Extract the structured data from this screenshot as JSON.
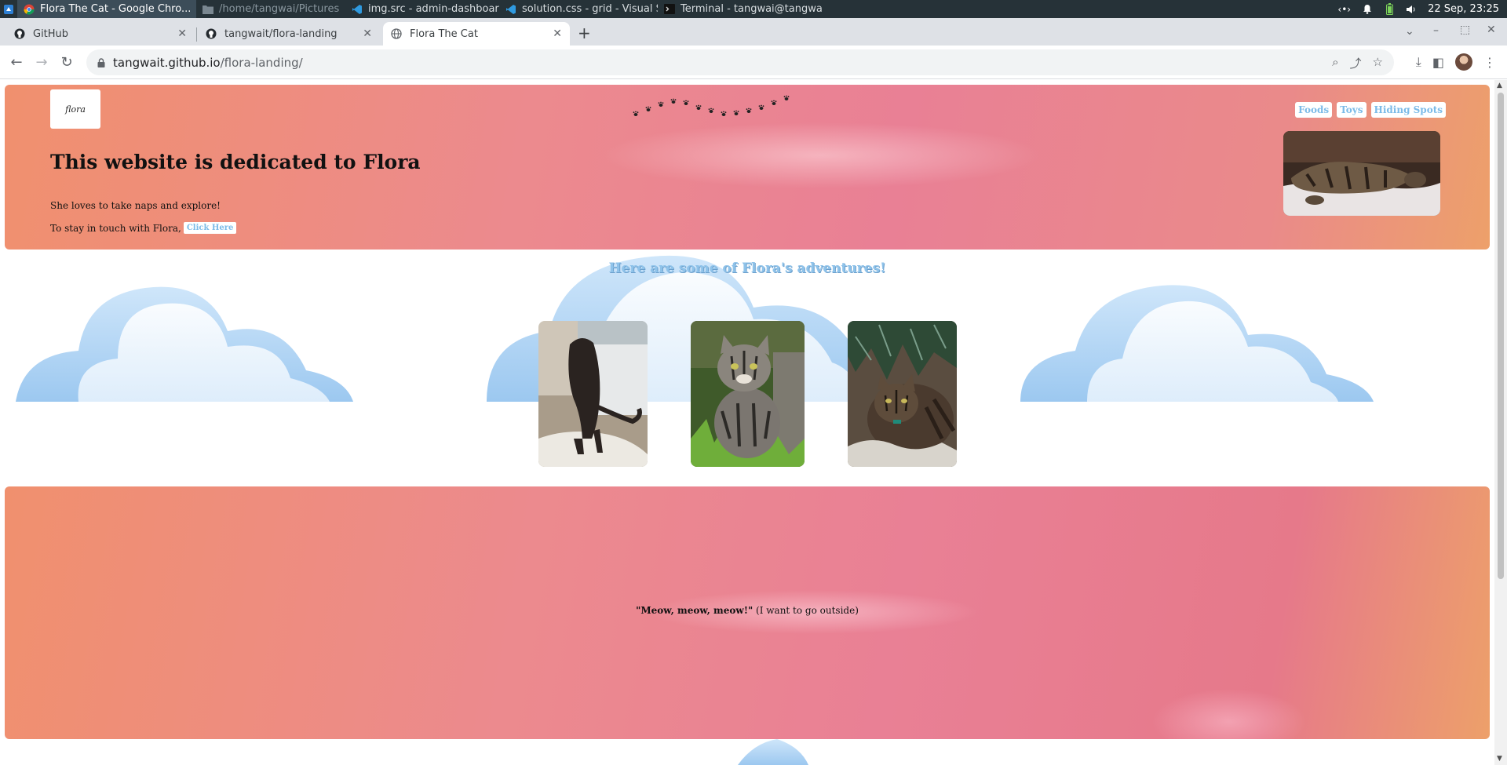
{
  "taskbar": {
    "windows": [
      {
        "title": "Flora The Cat - Google Chro...",
        "icon": "chrome-icon"
      },
      {
        "title": "/home/tangwai/Pictures",
        "icon": "folder-icon"
      },
      {
        "title": "img.src - admin-dashboard -...",
        "icon": "vscode-icon"
      },
      {
        "title": "solution.css - grid - Visual St...",
        "icon": "vscode-icon"
      },
      {
        "title": "Terminal - tangwai@tangwai...",
        "icon": "terminal-icon"
      }
    ],
    "clock": "22 Sep, 23:25"
  },
  "browser": {
    "tabs": [
      {
        "title": "GitHub",
        "icon": "github-icon"
      },
      {
        "title": "tangwait/flora-landing",
        "icon": "github-icon"
      },
      {
        "title": "Flora The Cat",
        "icon": "globe-icon"
      }
    ],
    "url_host": "tangwait.github.io",
    "url_path": "/flora-landing/"
  },
  "page": {
    "logo_text": "flora",
    "nav": [
      "Foods",
      "Toys",
      "Hiding Spots"
    ],
    "hero_title": "This website is dedicated to Flora",
    "hero_p1": "She loves to take naps and explore!",
    "hero_p2": "To stay in touch with Flora,",
    "cta": "Click Here",
    "adventures_title": "Here are some of Flora's adventures!",
    "quote_bold": "\"Meow, meow, meow!\"",
    "quote_rest": " (I want to go outside)"
  },
  "colors": {
    "accent_blue": "#7bbbe8",
    "hero_coral": "#f0906e",
    "hero_pink": "#e98095"
  }
}
